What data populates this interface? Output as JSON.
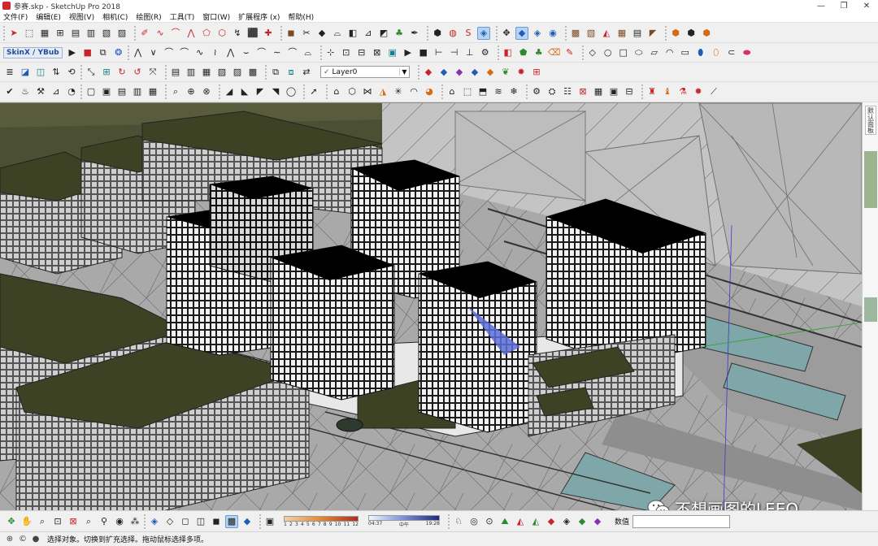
{
  "window": {
    "title": "参赛.skp - SketchUp Pro 2018",
    "controls": {
      "minimize": "—",
      "maximize": "❐",
      "close": "✕"
    }
  },
  "menu": [
    "文件(F)",
    "编辑(E)",
    "视图(V)",
    "相机(C)",
    "绘图(R)",
    "工具(T)",
    "窗口(W)",
    "扩展程序 (x)",
    "帮助(H)"
  ],
  "toolbars": {
    "skin_label": "SkinX / YBub",
    "layer": {
      "selected": "Layer0"
    }
  },
  "right_tray": {
    "tab_label": "默认面板"
  },
  "bottom_toolbar": {
    "month_ticks": [
      "1",
      "2",
      "3",
      "4",
      "5",
      "6",
      "7",
      "8",
      "9",
      "10",
      "11",
      "12"
    ],
    "time_start": "04:37",
    "time_mid": "中午",
    "time_end": "19:28",
    "value_label": "数值"
  },
  "status": {
    "text": "选择对象。切换到扩充选择。拖动鼠标选择多项。"
  },
  "watermark": {
    "text": "不想画图的LEEO"
  },
  "colors": {
    "roof_dark": "#000000",
    "roof_green": "#3e4224",
    "facade_grid": "#ffffff",
    "context_glass": "#9a9a9a",
    "water": "#7fa6a8",
    "selection_blue": "#5d6fd8"
  }
}
